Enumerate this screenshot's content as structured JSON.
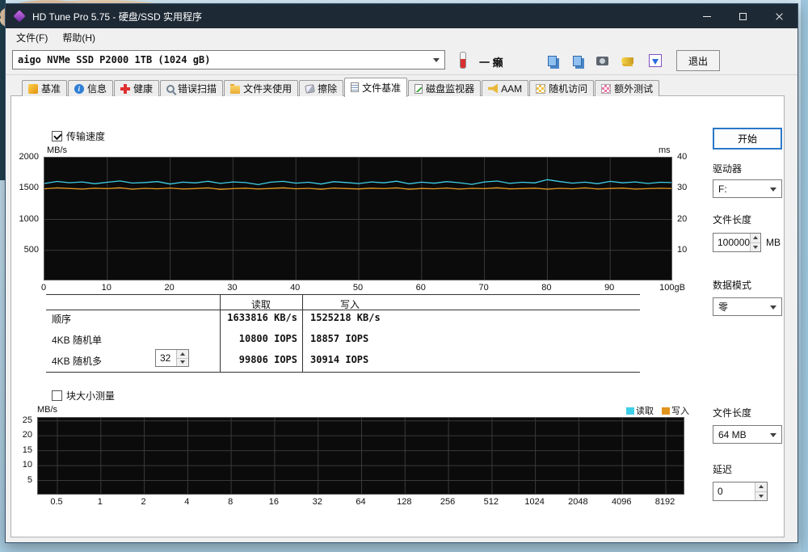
{
  "window": {
    "title": "HD Tune Pro 5.75 - 硬盘/SSD 实用程序"
  },
  "menu": {
    "file": "文件(F)",
    "help": "帮助(H)"
  },
  "toolbar": {
    "drive": "aigo NVMe SSD P2000 1TB (1024 gB)",
    "temperature": "一 癞",
    "exit": "退出",
    "icons": [
      "copy-icon",
      "copy-pages-icon",
      "camera-icon",
      "keys-icon",
      "save-down-icon"
    ]
  },
  "tabs": [
    {
      "name": "benchmark",
      "label": "基准",
      "selected": false
    },
    {
      "name": "info",
      "label": "信息",
      "selected": false
    },
    {
      "name": "health",
      "label": "健康",
      "selected": false
    },
    {
      "name": "error-scan",
      "label": "错误扫描",
      "selected": false
    },
    {
      "name": "folder-usage",
      "label": "文件夹使用",
      "selected": false
    },
    {
      "name": "erase",
      "label": "擦除",
      "selected": false
    },
    {
      "name": "file-benchmark",
      "label": "文件基准",
      "selected": true
    },
    {
      "name": "disk-monitor",
      "label": "磁盘监视器",
      "selected": false
    },
    {
      "name": "aam",
      "label": "AAM",
      "selected": false
    },
    {
      "name": "random-access",
      "label": "随机访问",
      "selected": false
    },
    {
      "name": "extra-tests",
      "label": "额外测试",
      "selected": false
    }
  ],
  "file_benchmark": {
    "transfer_speed_label": "传输速度",
    "block_size_label": "块大小测量",
    "table": {
      "read_header": "读取",
      "write_header": "写入",
      "rows": [
        {
          "label": "顺序",
          "read": "1633816 KB/s",
          "write": "1525218 KB/s"
        },
        {
          "label": "4KB 随机单",
          "read": "10800 IOPS",
          "write": "18857 IOPS"
        },
        {
          "label": "4KB 随机多",
          "spinner": "32",
          "read": "99806 IOPS",
          "write": "30914 IOPS"
        }
      ]
    },
    "controls": {
      "start": "开始",
      "drive_label": "驱动器",
      "drive_value": "F:",
      "file_length_label": "文件长度",
      "file_length_value": "100000",
      "file_length_unit": "MB",
      "data_mode_label": "数据模式",
      "data_mode_value": "零"
    },
    "legend": {
      "read": "读取",
      "write": "写入"
    },
    "bottom_controls": {
      "file_length_label": "文件长度",
      "file_length_value": "64 MB",
      "delay_label": "延迟",
      "delay_value": "0"
    }
  },
  "chart_data": [
    {
      "type": "line",
      "title": "传输速度",
      "ylabel": "MB/s",
      "y2label": "ms",
      "xlabel": "gB",
      "ylim": [
        0,
        2000
      ],
      "y2lim": [
        0,
        40
      ],
      "yticks": [
        2000,
        1500,
        1000,
        500
      ],
      "y2ticks": [
        40,
        30,
        20,
        10
      ],
      "xticks": [
        "0",
        "10",
        "20",
        "30",
        "40",
        "50",
        "60",
        "70",
        "80",
        "90",
        "100gB"
      ],
      "x_margin": 0,
      "grid": true,
      "series": [
        {
          "name": "读取",
          "color": "#3ecfe8",
          "values": [
            1582,
            1615,
            1594,
            1606,
            1578,
            1601,
            1622,
            1588,
            1597,
            1612,
            1573,
            1603,
            1591,
            1617,
            1583,
            1607,
            1596,
            1563,
            1602,
            1616,
            1587,
            1601,
            1572,
            1611,
            1597,
            1581,
            1606,
            1592,
            1618,
            1577,
            1602,
            1586,
            1612,
            1593,
            1567,
            1607,
            1621,
            1583,
            1601,
            1591,
            1643,
            1612,
            1587,
            1603,
            1578,
            1616,
            1592,
            1607,
            1582,
            1601,
            1596
          ]
        },
        {
          "name": "写入",
          "color": "#e2951d",
          "values": [
            1496,
            1511,
            1501,
            1490,
            1506,
            1498,
            1513,
            1489,
            1503,
            1496,
            1509,
            1492,
            1500,
            1511,
            1486,
            1498,
            1506,
            1491,
            1501,
            1512,
            1495,
            1503,
            1488,
            1509,
            1500,
            1493,
            1506,
            1498,
            1511,
            1487,
            1501,
            1495,
            1509,
            1490,
            1503,
            1498,
            1512,
            1494,
            1500,
            1506,
            1489,
            1503,
            1496,
            1511,
            1492,
            1501,
            1507,
            1490,
            1498,
            1504,
            1500
          ]
        }
      ]
    },
    {
      "type": "line",
      "title": "块大小测量",
      "ylabel": "MB/s",
      "ylim": [
        0,
        26
      ],
      "yticks": [
        25,
        20,
        15,
        10,
        5
      ],
      "xticks": [
        "0.5",
        "1",
        "2",
        "4",
        "8",
        "16",
        "32",
        "64",
        "128",
        "256",
        "512",
        "1024",
        "2048",
        "4096",
        "8192"
      ],
      "x_margin": 24,
      "grid": true,
      "series": []
    }
  ]
}
